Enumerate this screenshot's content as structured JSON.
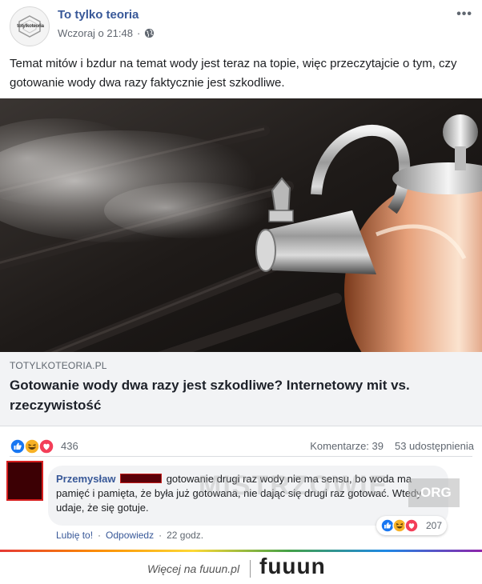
{
  "post": {
    "page_name": "To tylko teoria",
    "avatar_logo_text": "totylkoteoria",
    "timestamp": "Wczoraj o 21:48",
    "more_icon": "more-dots-icon",
    "text": "Temat mitów i bzdur na temat wody jest teraz na topie, więc przeczytajcie o tym, czy gotowanie wody dwa razy faktycznie jest szkodliwe."
  },
  "link_preview": {
    "domain": "TOTYLKOTEORIA.PL",
    "title": "Gotowanie wody dwa razy jest szkodliwe? Internetowy mit vs. rzeczywistość"
  },
  "reactions": {
    "icons": [
      "like-icon",
      "haha-icon",
      "love-icon"
    ],
    "count": "436",
    "comments": "Komentarze: 39",
    "shares": "53 udostępnienia"
  },
  "comment": {
    "author": "Przemysław",
    "text": "gotowanie drugi raz wody nie ma sensu, bo woda ma pamięć i pamięta, że była już gotowana, nie dając się drugi raz gotować. Wtedy udaje, że się gotuje.",
    "reaction_count": "207",
    "like_label": "Lubię to!",
    "reply_label": "Odpowiedz",
    "time": "22 godz.",
    "watermark": "MISTRZOWIE",
    "watermark_org": ".ORG"
  },
  "footer": {
    "text": "Więcej na fuuun.pl",
    "logo": "fuuun"
  },
  "colors": {
    "link_blue": "#385898",
    "like_blue": "#1877f2",
    "love_red": "#f33e58",
    "haha_yellow": "#f7b125",
    "redaction": "#5b0008"
  }
}
